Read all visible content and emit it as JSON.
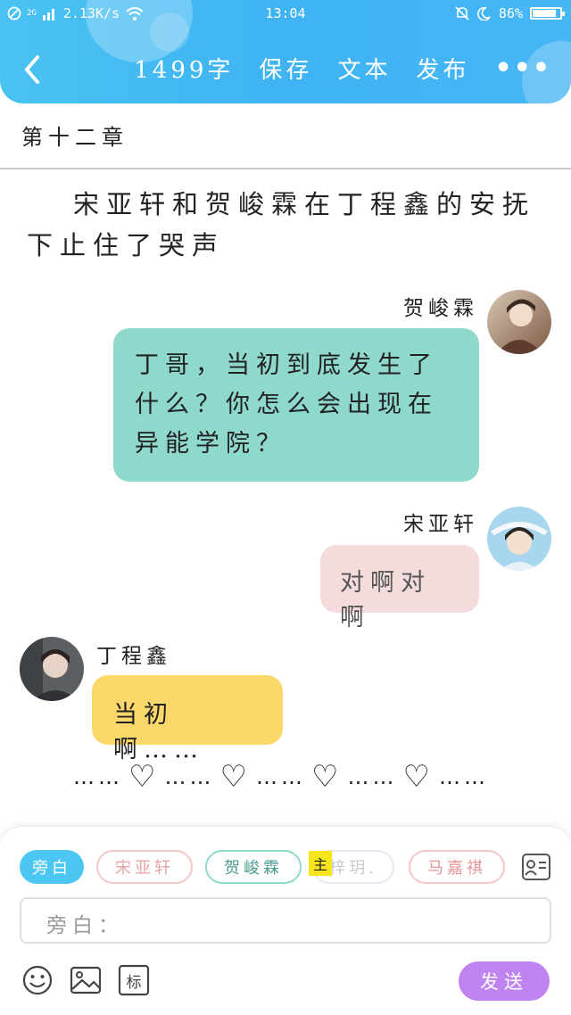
{
  "status_bar": {
    "network": "2G",
    "speed": "2.13K/s",
    "time": "13:04",
    "battery": "86%",
    "battery_level": 0.86
  },
  "header": {
    "word_count": "1499字",
    "save_label": "保存",
    "library_label": "文本",
    "publish_label": "发布",
    "more_label": "•••"
  },
  "chapter": {
    "title": "第十二章",
    "narration": "宋亚轩和贺峻霖在丁程鑫的安抚下止住了哭声"
  },
  "messages": [
    {
      "sender": "贺峻霖",
      "text_lines": [
        "丁哥，当初到底发生了",
        "什么？你怎么会出现在",
        "异能学院？"
      ],
      "color": "#8fd8cc"
    },
    {
      "sender": "宋亚轩",
      "text": "对啊对啊",
      "color": "#f4dcdc"
    },
    {
      "sender": "丁程鑫",
      "text": "当初啊……",
      "color": "#fcd86b"
    }
  ],
  "hearts_line": {
    "dots": "……",
    "heart": "♡"
  },
  "composer": {
    "chips": [
      "旁白",
      "宋亚轩",
      "贺峻霖",
      "梓玥.",
      "马嘉祺"
    ],
    "main_badge": "主",
    "input_label": "旁白：",
    "send_label": "发送",
    "tag_label": "标"
  },
  "colors": {
    "header_blue": "#3fb3f3",
    "active_chip": "#4cc6f2",
    "send_purple": "#c084f0"
  }
}
